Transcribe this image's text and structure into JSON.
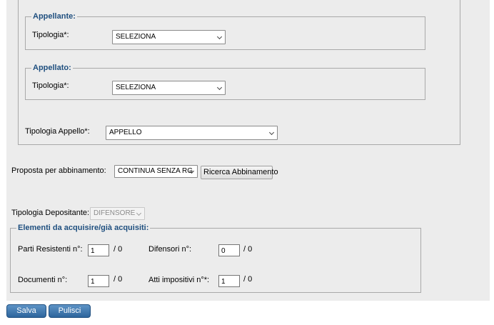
{
  "appellante": {
    "legend": "Appellante:",
    "tipologia_label": "Tipologia*:",
    "tipologia_value": "SELEZIONA"
  },
  "appellato": {
    "legend": "Appellato:",
    "tipologia_label": "Tipologia*:",
    "tipologia_value": "SELEZIONA"
  },
  "tipologia_appello": {
    "label": "Tipologia Appello*:",
    "value": "APPELLO"
  },
  "proposta": {
    "label": "Proposta per abbinamento:",
    "value": "CONTINUA SENZA RG",
    "button": "Ricerca Abbinamento"
  },
  "depositante": {
    "label": "Tipologia Depositante:",
    "value": "DIFENSORE"
  },
  "elementi": {
    "legend": "Elementi da acquisire/già acquisiti:",
    "parti_label": "Parti Resistenti n°:",
    "parti_value": "1",
    "parti_total": "/ 0",
    "difensori_label": "Difensori n°:",
    "difensori_value": "0",
    "difensori_total": "/ 0",
    "documenti_label": "Documenti n°:",
    "documenti_value": "1",
    "documenti_total": "/ 0",
    "atti_label": "Atti impositivi n°*:",
    "atti_value": "1",
    "atti_total": "/ 0"
  },
  "actions": {
    "save": "Salva",
    "clear": "Pulisci"
  }
}
